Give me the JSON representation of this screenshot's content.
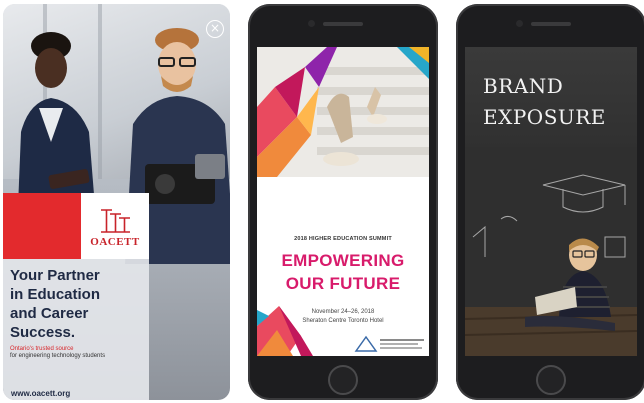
{
  "ad1": {
    "close_glyph": "×",
    "logo_text": "OACETT",
    "headline": "Your Partner\nin Education\nand Career\nSuccess.",
    "sub_red": "Ontario's trusted source",
    "sub_dark": "for engineering technology students",
    "website": "www.oacett.org"
  },
  "phone2": {
    "summit_label": "2018 HIGHER EDUCATION SUMMIT",
    "title": "EMPOWERING\nOUR FUTURE",
    "date": "November 24–26, 2018",
    "venue": "Sheraton Centre Toronto Hotel"
  },
  "phone3": {
    "title": "BRAND\nEXPOSURE"
  },
  "colors": {
    "oacett_red": "#e32a2d",
    "summit_pink": "#d81b6b",
    "phone_body": "#1d1d1f"
  }
}
